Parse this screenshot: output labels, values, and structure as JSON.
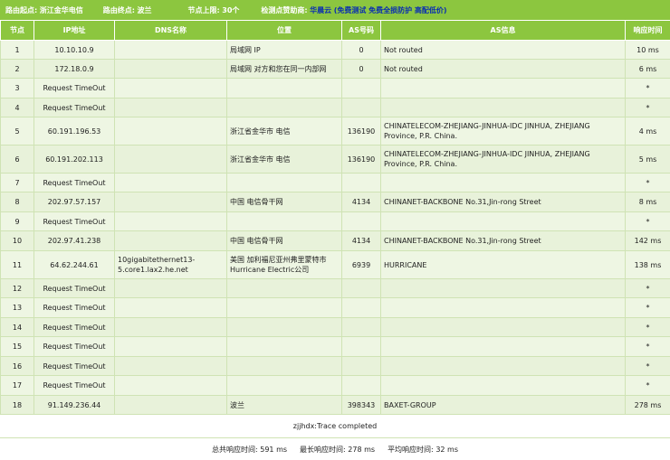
{
  "header": {
    "origin_label": "路由起点:",
    "origin_value": "浙江金华电信",
    "dest_label": "路由终点:",
    "dest_value": "波兰",
    "nodes_label": "节点上限:",
    "nodes_value": "30个",
    "sponsor_label": "检测点赞助商:",
    "sponsor_name": "华晨云",
    "sponsor_links": "(免费测试 免费全损防护 高配低价)"
  },
  "columns": [
    "节点",
    "IP地址",
    "DNS名称",
    "位置",
    "AS号码",
    "AS信息",
    "响应时间"
  ],
  "rows": [
    {
      "hop": "1",
      "ip": "10.10.10.9",
      "dns": "",
      "loc": "局域网 IP",
      "as": "0",
      "asinfo": "Not routed",
      "time": "10 ms"
    },
    {
      "hop": "2",
      "ip": "172.18.0.9",
      "dns": "",
      "loc": "局域网 对方和您在同一内部网",
      "as": "0",
      "asinfo": "Not routed",
      "time": "6 ms"
    },
    {
      "hop": "3",
      "ip": "Request TimeOut",
      "dns": "",
      "loc": "",
      "as": "",
      "asinfo": "",
      "time": "*"
    },
    {
      "hop": "4",
      "ip": "Request TimeOut",
      "dns": "",
      "loc": "",
      "as": "",
      "asinfo": "",
      "time": "*"
    },
    {
      "hop": "5",
      "ip": "60.191.196.53",
      "dns": "",
      "loc": "浙江省金华市 电信",
      "as": "136190",
      "asinfo": "CHINATELECOM-ZHEJIANG-JINHUA-IDC JINHUA, ZHEJIANG Province, P.R. China.",
      "time": "4 ms"
    },
    {
      "hop": "6",
      "ip": "60.191.202.113",
      "dns": "",
      "loc": "浙江省金华市 电信",
      "as": "136190",
      "asinfo": "CHINATELECOM-ZHEJIANG-JINHUA-IDC JINHUA, ZHEJIANG Province, P.R. China.",
      "time": "5 ms"
    },
    {
      "hop": "7",
      "ip": "Request TimeOut",
      "dns": "",
      "loc": "",
      "as": "",
      "asinfo": "",
      "time": "*"
    },
    {
      "hop": "8",
      "ip": "202.97.57.157",
      "dns": "",
      "loc": "中国 电信骨干网",
      "as": "4134",
      "asinfo": "CHINANET-BACKBONE No.31,Jin-rong Street",
      "time": "8 ms"
    },
    {
      "hop": "9",
      "ip": "Request TimeOut",
      "dns": "",
      "loc": "",
      "as": "",
      "asinfo": "",
      "time": "*"
    },
    {
      "hop": "10",
      "ip": "202.97.41.238",
      "dns": "",
      "loc": "中国 电信骨干网",
      "as": "4134",
      "asinfo": "CHINANET-BACKBONE No.31,Jin-rong Street",
      "time": "142 ms"
    },
    {
      "hop": "11",
      "ip": "64.62.244.61",
      "dns": "10gigabitethernet13-5.core1.lax2.he.net",
      "loc": "美国 加利福尼亚州弗里蒙特市Hurricane Electric公司",
      "as": "6939",
      "asinfo": "HURRICANE",
      "time": "138 ms"
    },
    {
      "hop": "12",
      "ip": "Request TimeOut",
      "dns": "",
      "loc": "",
      "as": "",
      "asinfo": "",
      "time": "*"
    },
    {
      "hop": "13",
      "ip": "Request TimeOut",
      "dns": "",
      "loc": "",
      "as": "",
      "asinfo": "",
      "time": "*"
    },
    {
      "hop": "14",
      "ip": "Request TimeOut",
      "dns": "",
      "loc": "",
      "as": "",
      "asinfo": "",
      "time": "*"
    },
    {
      "hop": "15",
      "ip": "Request TimeOut",
      "dns": "",
      "loc": "",
      "as": "",
      "asinfo": "",
      "time": "*"
    },
    {
      "hop": "16",
      "ip": "Request TimeOut",
      "dns": "",
      "loc": "",
      "as": "",
      "asinfo": "",
      "time": "*"
    },
    {
      "hop": "17",
      "ip": "Request TimeOut",
      "dns": "",
      "loc": "",
      "as": "",
      "asinfo": "",
      "time": "*"
    },
    {
      "hop": "18",
      "ip": "91.149.236.44",
      "dns": "",
      "loc": "波兰",
      "as": "398343",
      "asinfo": "BAXET-GROUP",
      "time": "278 ms"
    }
  ],
  "footer": {
    "status": "zjjhdx:Trace completed",
    "total_label": "总共响应时间:",
    "total_value": "591 ms",
    "max_label": "最长响应时间:",
    "max_value": "278 ms",
    "avg_label": "平均响应时间:",
    "avg_value": "32 ms"
  }
}
